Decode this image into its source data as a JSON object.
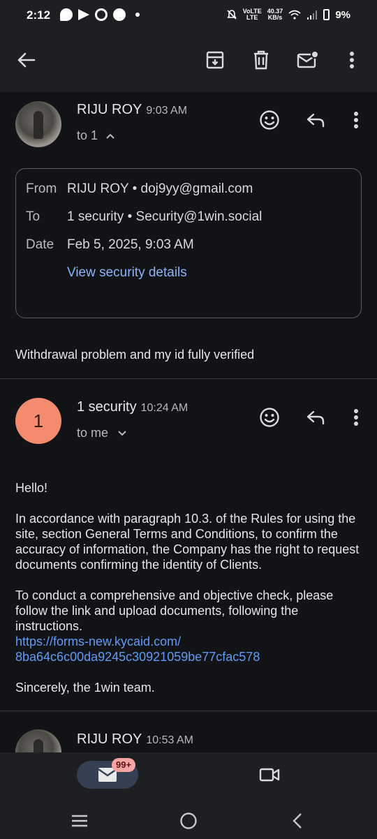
{
  "status_bar": {
    "time": "2:12",
    "network_speed_top": "40.37",
    "network_speed_bottom": "KB/s",
    "network_type": "LTE",
    "battery": "9%"
  },
  "toolbar": {
    "back_icon": "arrow-left-icon",
    "archive_icon": "archive-icon",
    "delete_icon": "trash-icon",
    "mark_unread_icon": "mail-unread-icon",
    "more_icon": "more-vert-icon"
  },
  "message1": {
    "sender": "RIJU ROY",
    "time": "9:03 AM",
    "to": "to 1",
    "details": {
      "from_label": "From",
      "from_value": "RIJU ROY • doj9yy@gmail.com",
      "to_label": "To",
      "to_value": "1 security • Security@1win.social",
      "date_label": "Date",
      "date_value": "Feb 5, 2025, 9:03 AM",
      "link": "View security details"
    },
    "snippet": "Withdrawal problem and my id fully verified"
  },
  "message2": {
    "avatar_letter": "1",
    "sender": "1 security",
    "time": "10:24 AM",
    "to": "to me",
    "body": {
      "greeting": "Hello!",
      "paragraph1": "In accordance with paragraph 10.3. of the Rules for using the site, section General Terms and Conditions, to confirm the accuracy of information, the Company has the right to request documents confirming the identity of Clients.",
      "paragraph2": "To conduct a comprehensive and objective check, please follow the link and upload documents, following the instructions.",
      "link_line1": "https://forms-new.kycaid.com/",
      "link_line2": "8ba64c6c00da9245c30921059be77cfac578",
      "signoff": "Sincerely, the 1win team."
    }
  },
  "message3": {
    "sender": "RIJU ROY",
    "time": "10:53 AM"
  },
  "bottom_nav": {
    "mail_badge": "99+"
  },
  "colors": {
    "background": "#121316",
    "bar": "#1e1f22",
    "link": "#8ab4f8",
    "avatar_letter_bg": "#f48b6e",
    "badge_bg": "#f7a3a3"
  }
}
